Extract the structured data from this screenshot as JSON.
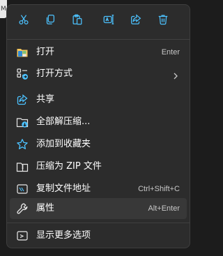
{
  "background_window": {
    "tab_text": "M"
  },
  "toolbar": {
    "buttons": [
      {
        "icon": "cut-icon"
      },
      {
        "icon": "copy-icon"
      },
      {
        "icon": "paste-icon"
      },
      {
        "icon": "rename-icon"
      },
      {
        "icon": "share-icon"
      },
      {
        "icon": "delete-icon"
      }
    ]
  },
  "menu": {
    "items": [
      {
        "label": "打开",
        "accelerator": "Enter",
        "icon": "open-icon"
      },
      {
        "label": "打开方式",
        "accelerator": "",
        "icon": "open-with-icon",
        "submenu": true
      },
      {
        "label": "共享",
        "accelerator": "",
        "icon": "share-icon"
      },
      {
        "label": "全部解压缩...",
        "accelerator": "",
        "icon": "extract-all-icon"
      },
      {
        "label": "添加到收藏夹",
        "accelerator": "",
        "icon": "star-icon"
      },
      {
        "label": "压缩为 ZIP 文件",
        "accelerator": "",
        "icon": "zip-folder-icon"
      },
      {
        "label": "复制文件地址",
        "accelerator": "Ctrl+Shift+C",
        "icon": "copy-path-icon"
      },
      {
        "label": "属性",
        "accelerator": "Alt+Enter",
        "icon": "properties-icon",
        "highlighted": true
      },
      {
        "label": "显示更多选项",
        "accelerator": "",
        "icon": "more-options-icon"
      }
    ]
  },
  "colors": {
    "menu_background": "#2c2c2c",
    "accent": "#4cc2ff",
    "folder_yellow": "#f2c55c",
    "highlight": "#383838"
  }
}
